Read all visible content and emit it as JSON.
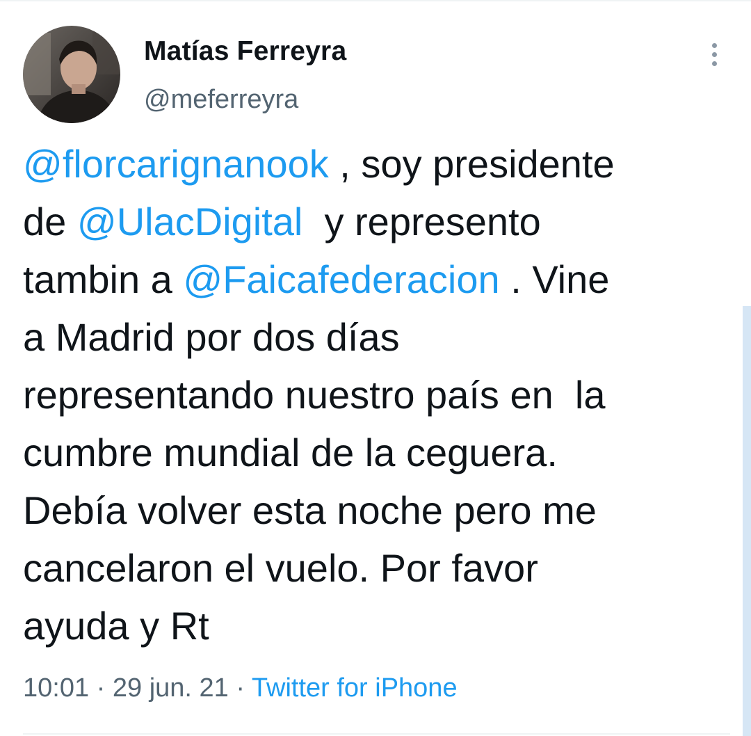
{
  "author": {
    "name": "Matías Ferreyra",
    "handle": "@meferreyra",
    "avatar_icon": "user-photo"
  },
  "more_icon": "more-vertical-icon",
  "tweet": {
    "lines": [
      {
        "parts": [
          {
            "text": "@florcarignanook",
            "type": "mention"
          },
          {
            "text": " , soy presidente",
            "type": "text"
          }
        ]
      },
      {
        "parts": [
          {
            "text": "de ",
            "type": "text"
          },
          {
            "text": "@UlacDigital",
            "type": "mention"
          },
          {
            "text": "  y represento",
            "type": "text"
          }
        ]
      },
      {
        "parts": [
          {
            "text": "tambin a ",
            "type": "text"
          },
          {
            "text": "@Faicafederacion",
            "type": "mention"
          },
          {
            "text": " . Vine",
            "type": "text"
          }
        ]
      },
      {
        "parts": [
          {
            "text": "a Madrid por dos días",
            "type": "text"
          }
        ]
      },
      {
        "parts": [
          {
            "text": "representando nuestro país en  la",
            "type": "text"
          }
        ]
      },
      {
        "parts": [
          {
            "text": "cumbre mundial de la ceguera.",
            "type": "text"
          }
        ]
      },
      {
        "parts": [
          {
            "text": "Debía volver esta noche pero me",
            "type": "text"
          }
        ]
      },
      {
        "parts": [
          {
            "text": "cancelaron el vuelo. Por favor",
            "type": "text"
          }
        ]
      },
      {
        "parts": [
          {
            "text": "ayuda y Rt",
            "type": "text"
          }
        ]
      }
    ]
  },
  "meta": {
    "time": "10:01",
    "separator": " · ",
    "date": "29 jun. 21",
    "source": "Twitter for iPhone"
  },
  "colors": {
    "link": "#1d9bf0",
    "text": "#0f1419",
    "secondary": "#536471"
  }
}
